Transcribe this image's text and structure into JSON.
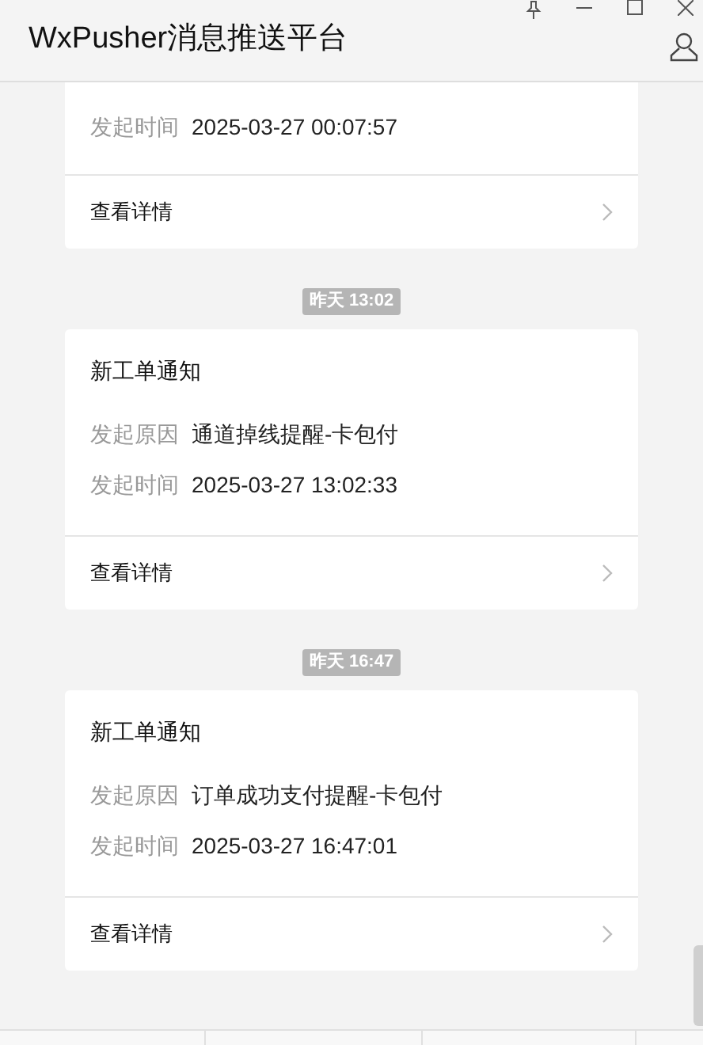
{
  "window": {
    "title": "WxPusher消息推送平台"
  },
  "messages": [
    {
      "rows": [
        {
          "label": "发起时间",
          "value": "2025-03-27 00:07:57"
        }
      ],
      "link": "查看详情"
    },
    {
      "timestamp": "昨天 13:02",
      "title": "新工单通知",
      "rows": [
        {
          "label": "发起原因",
          "value": "通道掉线提醒-卡包付"
        },
        {
          "label": "发起时间",
          "value": "2025-03-27 13:02:33"
        }
      ],
      "link": "查看详情"
    },
    {
      "timestamp": "昨天 16:47",
      "title": "新工单通知",
      "rows": [
        {
          "label": "发起原因",
          "value": "订单成功支付提醒-卡包付"
        },
        {
          "label": "发起时间",
          "value": "2025-03-27 16:47:01"
        }
      ],
      "link": "查看详情"
    }
  ]
}
